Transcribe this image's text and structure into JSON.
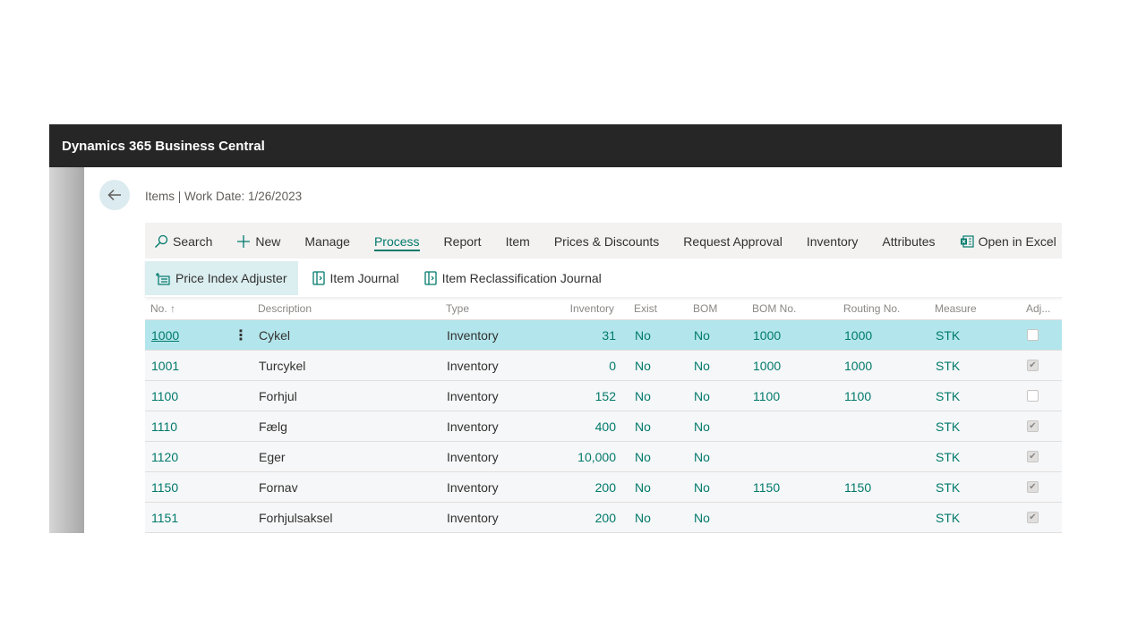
{
  "app": {
    "title": "Dynamics 365 Business Central"
  },
  "page": {
    "breadcrumb": "Items | Work Date: 1/26/2023"
  },
  "actions": [
    {
      "label": "Search",
      "icon": "search-icon"
    },
    {
      "label": "New",
      "icon": "plus-icon"
    },
    {
      "label": "Manage"
    },
    {
      "label": "Process",
      "active": true
    },
    {
      "label": "Report"
    },
    {
      "label": "Item"
    },
    {
      "label": "Prices & Discounts"
    },
    {
      "label": "Request Approval"
    },
    {
      "label": "Inventory"
    },
    {
      "label": "Attributes"
    },
    {
      "label": "Open in Excel",
      "icon": "excel-icon"
    }
  ],
  "subactions": [
    {
      "label": "Price Index Adjuster",
      "icon": "price-index-icon",
      "highlighted": true
    },
    {
      "label": "Item Journal",
      "icon": "journal-icon"
    },
    {
      "label": "Item Reclassification Journal",
      "icon": "journal-icon"
    }
  ],
  "columns": {
    "no": "No. ↑",
    "description": "Description",
    "type": "Type",
    "inventory": "Inventory",
    "exist": "Exist",
    "bom": "BOM",
    "bom_no": "BOM No.",
    "routing_no": "Routing No.",
    "measure": "Measure",
    "adj": "Adj..."
  },
  "rows": [
    {
      "no": "1000",
      "description": "Cykel",
      "type": "Inventory",
      "inventory": "31",
      "exist": "No",
      "bom": "No",
      "bom_no": "1000",
      "routing_no": "1000",
      "measure": "STK",
      "adj": false,
      "selected": true
    },
    {
      "no": "1001",
      "description": "Turcykel",
      "type": "Inventory",
      "inventory": "0",
      "exist": "No",
      "bom": "No",
      "bom_no": "1000",
      "routing_no": "1000",
      "measure": "STK",
      "adj": true
    },
    {
      "no": "1100",
      "description": "Forhjul",
      "type": "Inventory",
      "inventory": "152",
      "exist": "No",
      "bom": "No",
      "bom_no": "1100",
      "routing_no": "1100",
      "measure": "STK",
      "adj": false
    },
    {
      "no": "1110",
      "description": "Fælg",
      "type": "Inventory",
      "inventory": "400",
      "exist": "No",
      "bom": "No",
      "bom_no": "",
      "routing_no": "",
      "measure": "STK",
      "adj": true
    },
    {
      "no": "1120",
      "description": "Eger",
      "type": "Inventory",
      "inventory": "10,000",
      "exist": "No",
      "bom": "No",
      "bom_no": "",
      "routing_no": "",
      "measure": "STK",
      "adj": true
    },
    {
      "no": "1150",
      "description": "Fornav",
      "type": "Inventory",
      "inventory": "200",
      "exist": "No",
      "bom": "No",
      "bom_no": "1150",
      "routing_no": "1150",
      "measure": "STK",
      "adj": true
    },
    {
      "no": "1151",
      "description": "Forhjulsaksel",
      "type": "Inventory",
      "inventory": "200",
      "exist": "No",
      "bom": "No",
      "bom_no": "",
      "routing_no": "",
      "measure": "STK",
      "adj": true
    }
  ],
  "colors": {
    "accent": "#00796b",
    "selected_row": "#b3e6ec",
    "topbar": "#262626"
  }
}
